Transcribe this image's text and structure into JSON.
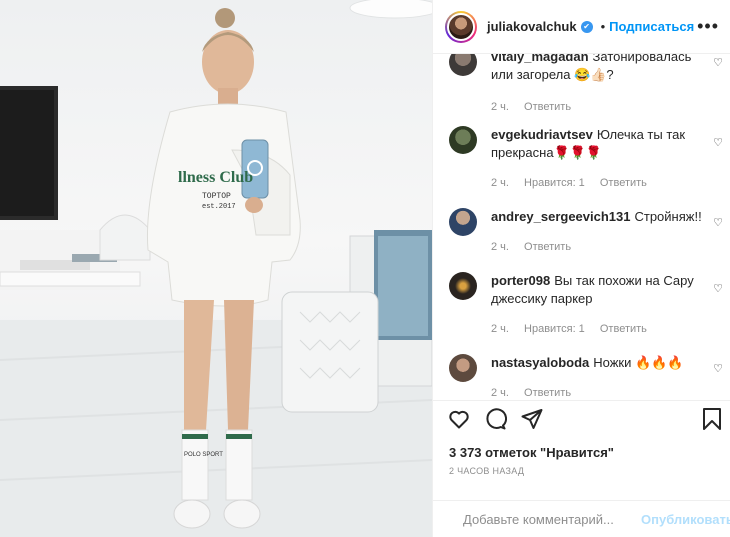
{
  "post": {
    "username": "juliakovalchuk",
    "follow_label": "Подписаться",
    "separator": "•",
    "more_label": "•••"
  },
  "photo": {
    "shirt_text": "llness Club",
    "shirt_sub1": "ТОРТОР",
    "shirt_sub2": "est.2017",
    "sock_text": "POLO SPORT"
  },
  "comments": [
    {
      "user": "vitaly_magadan",
      "text": "Затонировалась или загорела 😂👍🏻?",
      "time": "2 ч.",
      "likes": "",
      "reply": "Ответить"
    },
    {
      "user": "evgekudriavtsev",
      "text": "Юлечка ты так прекрасна🌹🌹🌹",
      "time": "2 ч.",
      "likes": "Нравится: 1",
      "reply": "Ответить"
    },
    {
      "user": "andrey_sergeevich131",
      "text": "Стройняж!!",
      "time": "2 ч.",
      "likes": "",
      "reply": "Ответить"
    },
    {
      "user": "porter098",
      "text": "Вы так похожи на Сару джессику паркер",
      "time": "2 ч.",
      "likes": "Нравится: 1",
      "reply": "Ответить"
    },
    {
      "user": "nastasyaloboda",
      "text": "Ножки 🔥🔥🔥",
      "time": "2 ч.",
      "likes": "",
      "reply": "Ответить"
    }
  ],
  "likes_text": "3 373 отметок \"Нравится\"",
  "time_ago": "2 ЧАСОВ НАЗАД",
  "comment_input": {
    "placeholder": "Добавьте комментарий...",
    "publish_label": "Опубликовать"
  },
  "colors": {
    "accent": "#0095f6",
    "verified": "#3897f0",
    "publish_disabled": "#b2dffc"
  }
}
